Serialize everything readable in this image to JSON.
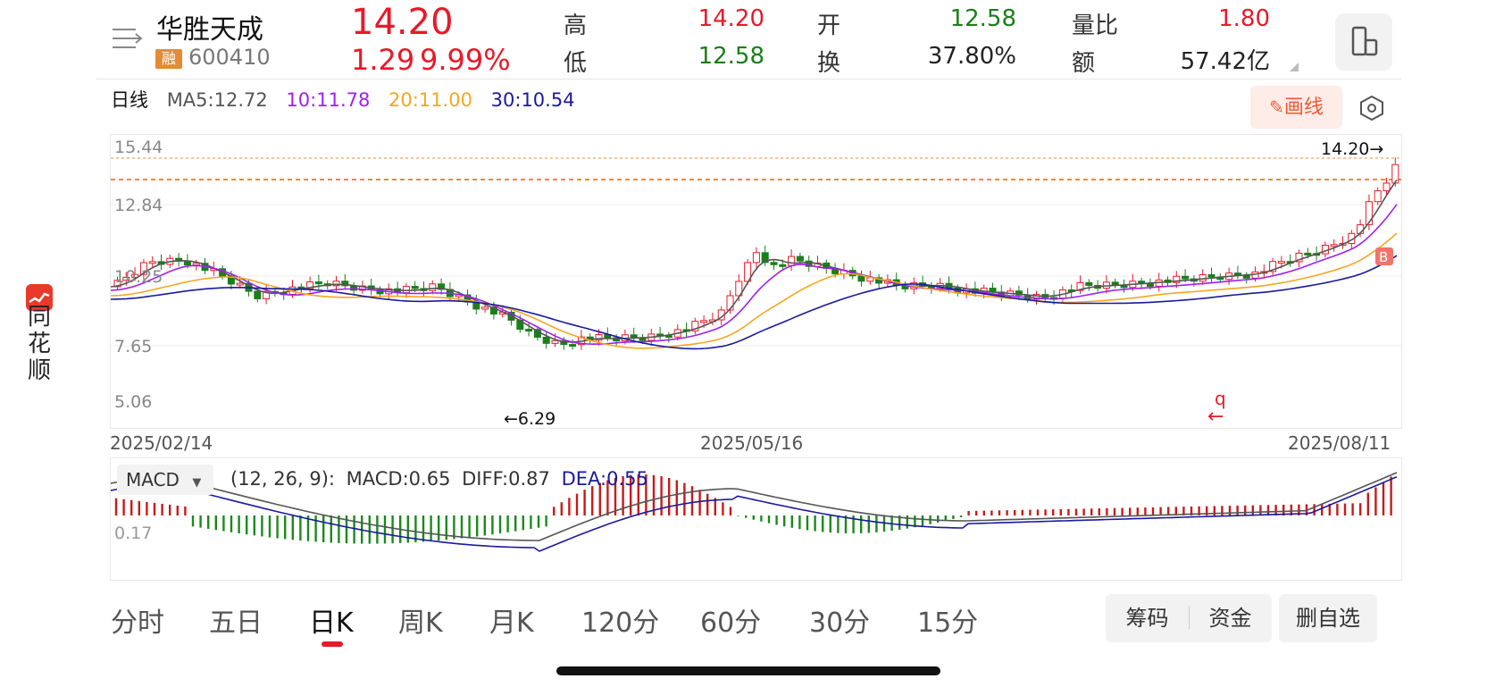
{
  "brand": {
    "chars": [
      "同",
      "花",
      "顺"
    ]
  },
  "stock": {
    "name": "华胜天成",
    "badge": "融",
    "code": "600410",
    "price": "14.20",
    "change": "1.29",
    "change_pct": "9.99%"
  },
  "quote": {
    "high_label": "高",
    "high": "14.20",
    "low_label": "低",
    "low": "12.58",
    "open_label": "开",
    "open": "12.58",
    "turnover_label": "换",
    "turnover": "37.80%",
    "vol_ratio_label": "量比",
    "vol_ratio": "1.80",
    "amount_label": "额",
    "amount": "57.42亿"
  },
  "colors": {
    "up": "#e8192a",
    "down": "#1a7f1a",
    "ma5": "#555555",
    "ma10": "#a020f0",
    "ma20": "#f5a623",
    "ma30": "#1a1a9e",
    "macd_diff": "#555555",
    "macd_dea": "#1a1a9e",
    "dashed": "#f08c2e"
  },
  "ma_bar": {
    "period": "日线",
    "ma5": "MA5:12.72",
    "ma10": "10:11.78",
    "ma20": "20:11.00",
    "ma30": "30:10.54"
  },
  "draw_button": "画线",
  "settings_icon": "hexagon-settings-icon",
  "kline": {
    "y_ticks": [
      "15.44",
      "12.84",
      "10.25",
      "7.65",
      "5.06"
    ],
    "last_price_tag": "14.20→",
    "low_tag": "←6.29",
    "buy_marker": "B",
    "dates": [
      "2025/02/14",
      "2025/05/16",
      "2025/08/11"
    ]
  },
  "chart_data": [
    {
      "type": "candlestick",
      "title": "",
      "y_ticks": [
        15.44,
        12.84,
        10.25,
        7.65,
        5.06
      ],
      "ylim": [
        5.06,
        15.44
      ],
      "x_ticks": [
        "2025/02/14",
        "2025/05/16",
        "2025/08/11"
      ],
      "annotations": {
        "high": 14.2,
        "low": 6.29
      },
      "series": [
        {
          "name": "MA5",
          "last": 12.72
        },
        {
          "name": "MA10",
          "last": 11.78
        },
        {
          "name": "MA20",
          "last": 11.0
        },
        {
          "name": "MA30",
          "last": 10.54
        }
      ]
    },
    {
      "type": "bar",
      "title": "MACD",
      "params": "(12, 26, 9)",
      "y_tick": "0.17",
      "series": [
        {
          "name": "MACD",
          "last": 0.65
        },
        {
          "name": "DIFF",
          "last": 0.87
        },
        {
          "name": "DEA",
          "last": 0.55
        }
      ]
    }
  ],
  "macd": {
    "select": "MACD",
    "params": "(12, 26, 9):",
    "macd": "MACD:0.65",
    "diff": "DIFF:0.87",
    "dea": "DEA:0.55",
    "y_tick": "0.17"
  },
  "tabs": [
    "分时",
    "五日",
    "日K",
    "周K",
    "月K",
    "120分",
    "60分",
    "30分",
    "15分"
  ],
  "buttons": {
    "chips": "筹码",
    "funds": "资金",
    "remove": "删自选"
  }
}
